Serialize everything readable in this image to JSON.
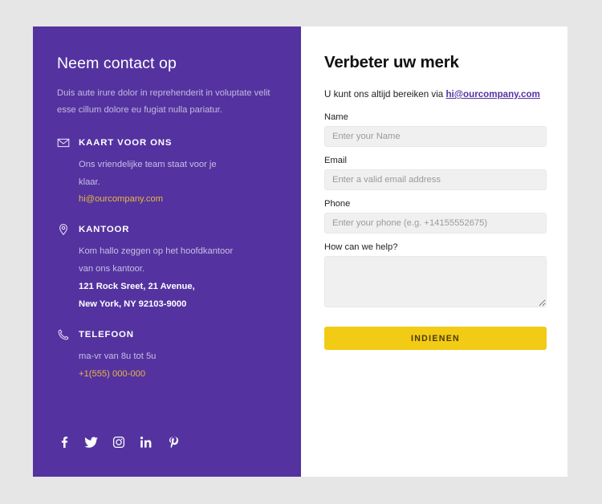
{
  "theme": {
    "purple": "#5433a0",
    "accent_yellow": "#e9b642",
    "button_yellow": "#f2cb14",
    "page_background": "#e6e6e6"
  },
  "left": {
    "title": "Neem contact op",
    "intro": "Duis aute irure dolor in reprehenderit in voluptate velit esse cillum dolore eu fugiat nulla pariatur.",
    "blocks": [
      {
        "icon": "envelope-icon",
        "title": "KAART VOOR ONS",
        "line1": "Ons vriendelijke team staat voor je",
        "line2": "klaar.",
        "link": "hi@ourcompany.com"
      },
      {
        "icon": "location-pin-icon",
        "title": "KANTOOR",
        "line1": "Kom hallo zeggen op het hoofdkantoor",
        "line2": "van ons kantoor.",
        "address1": "121 Rock Sreet, 21 Avenue,",
        "address2": "New York, NY 92103-9000"
      },
      {
        "icon": "phone-icon",
        "title": "TELEFOON",
        "line1": "ma-vr van 8u tot 5u",
        "link": "+1(555) 000-000"
      }
    ],
    "socials": [
      {
        "name": "facebook-icon",
        "label": "Facebook"
      },
      {
        "name": "twitter-icon",
        "label": "Twitter"
      },
      {
        "name": "instagram-icon",
        "label": "Instagram"
      },
      {
        "name": "linkedin-icon",
        "label": "LinkedIn"
      },
      {
        "name": "pinterest-icon",
        "label": "Pinterest"
      }
    ]
  },
  "right": {
    "title": "Verbeter uw merk",
    "subtitle_prefix": "U kunt ons altijd bereiken via ",
    "subtitle_link": "hi@ourcompany.com",
    "fields": {
      "name": {
        "label": "Name",
        "placeholder": "Enter your Name",
        "value": ""
      },
      "email": {
        "label": "Email",
        "placeholder": "Enter a valid email address",
        "value": ""
      },
      "phone": {
        "label": "Phone",
        "placeholder": "Enter your phone (e.g. +14155552675)",
        "value": ""
      },
      "message": {
        "label": "How can we help?",
        "placeholder": "",
        "value": ""
      }
    },
    "submit_label": "INDIENEN"
  }
}
